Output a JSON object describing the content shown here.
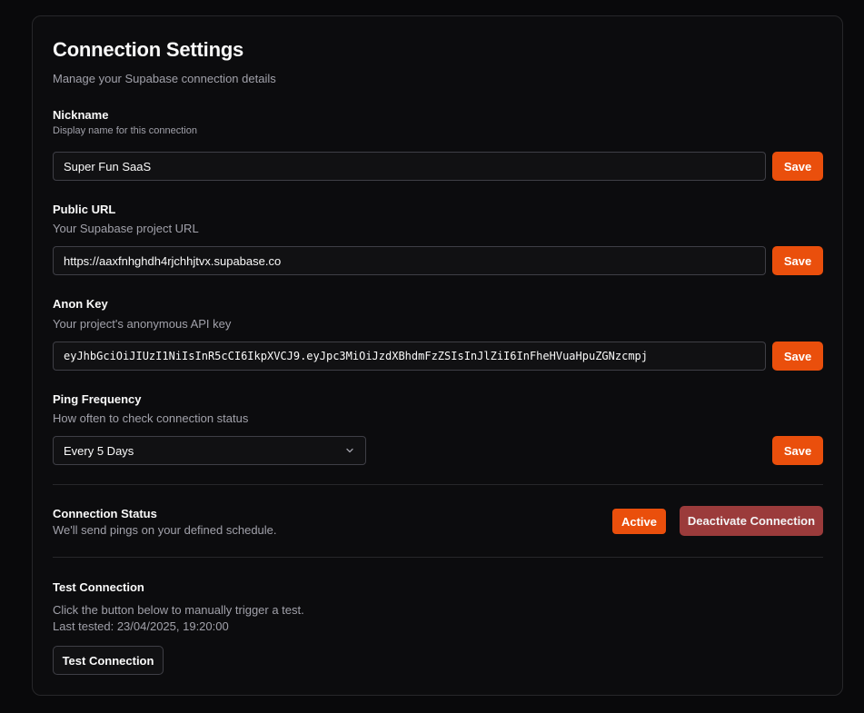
{
  "header": {
    "title": "Connection Settings",
    "subtitle": "Manage your Supabase connection details"
  },
  "nickname": {
    "label": "Nickname",
    "description": "Display name for this connection",
    "value": "Super Fun SaaS",
    "save_label": "Save"
  },
  "public_url": {
    "label": "Public URL",
    "description": "Your Supabase project URL",
    "value": "https://aaxfnhghdh4rjchhjtvx.supabase.co",
    "save_label": "Save"
  },
  "anon_key": {
    "label": "Anon Key",
    "description": "Your project's anonymous API key",
    "value": "eyJhbGciOiJIUzI1NiIsInR5cCI6IkpXVCJ9.eyJpc3MiOiJzdXBhdmFzZSIsInJlZiI6InFheHVuaHpuZGNzcmpj",
    "save_label": "Save"
  },
  "ping_frequency": {
    "label": "Ping Frequency",
    "description": "How often to check connection status",
    "selected": "Every 5 Days",
    "save_label": "Save",
    "icon": "chevron-down-icon"
  },
  "status": {
    "label": "Connection Status",
    "description": "We'll send pings on your defined schedule.",
    "badge": "Active",
    "deactivate_label": "Deactivate Connection"
  },
  "test": {
    "label": "Test Connection",
    "description": "Click the button below to manually trigger a test.",
    "last_tested": "Last tested: 23/04/2025, 19:20:00",
    "button_label": "Test Connection"
  },
  "colors": {
    "accent": "#ea4f0c",
    "danger": "#9b3b3b",
    "background": "#09090b",
    "border": "#27272a"
  }
}
